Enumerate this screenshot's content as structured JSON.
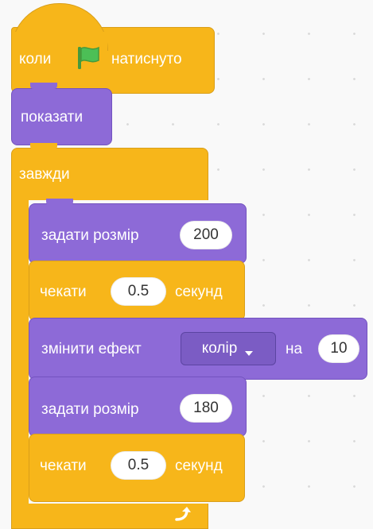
{
  "colors": {
    "events": "#f7b61a",
    "control": "#f7b61a",
    "looks": "#8d6ad7",
    "flag": "#4cbf56"
  },
  "blocks": {
    "when_flag": {
      "before": "коли",
      "icon": "green-flag-icon",
      "after": "натиснуто"
    },
    "show": {
      "label": "показати"
    },
    "forever": {
      "label": "завжди",
      "icon": "loop-arrow-icon"
    },
    "set_size_1": {
      "label": "задати розмір",
      "value": "200"
    },
    "wait_1": {
      "label": "чекати",
      "value": "0.5",
      "suffix": "секунд"
    },
    "change_effect": {
      "label": "змінити ефект",
      "effect": "колір",
      "to_label": "на",
      "value": "10"
    },
    "set_size_2": {
      "label": "задати розмір",
      "value": "180"
    },
    "wait_2": {
      "label": "чекати",
      "value": "0.5",
      "suffix": "секунд"
    }
  }
}
